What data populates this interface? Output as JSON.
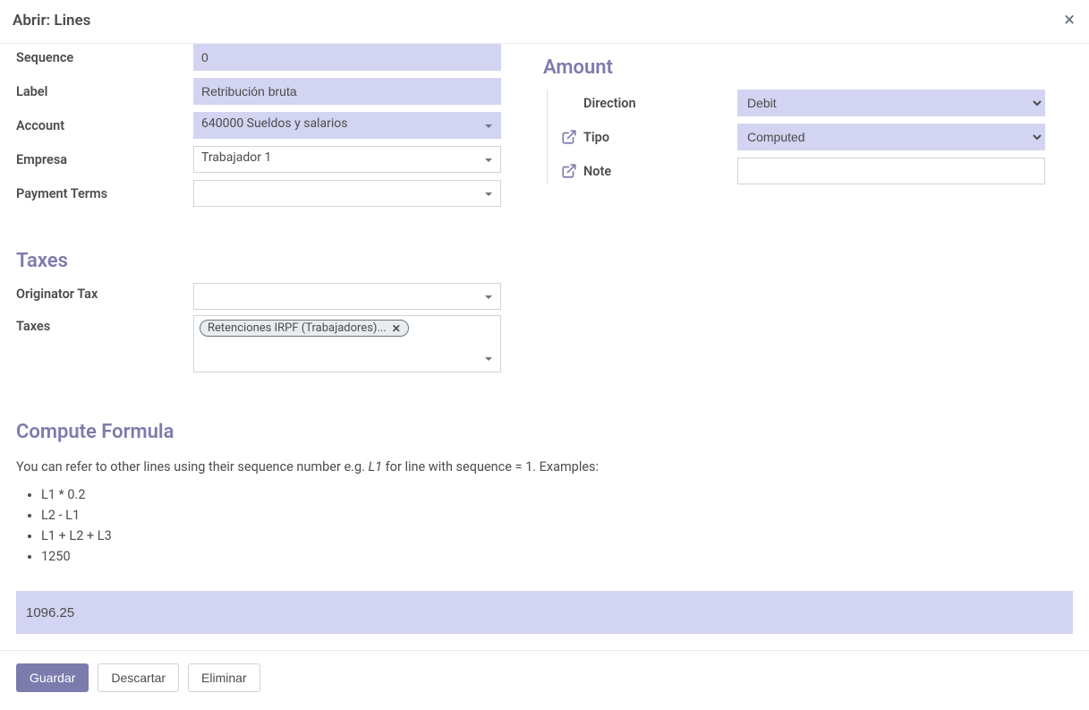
{
  "header": {
    "title": "Abrir: Lines"
  },
  "left": {
    "sequence_label": "Sequence",
    "sequence_value": "0",
    "label_label": "Label",
    "label_value": "Retribución bruta",
    "account_label": "Account",
    "account_value": "640000 Sueldos y salarios",
    "empresa_label": "Empresa",
    "empresa_value": "Trabajador 1",
    "payment_terms_label": "Payment Terms",
    "payment_terms_value": ""
  },
  "amount": {
    "title": "Amount",
    "direction_label": "Direction",
    "direction_value": "Debit",
    "tipo_label": "Tipo",
    "tipo_value": "Computed",
    "note_label": "Note",
    "note_value": ""
  },
  "taxes": {
    "title": "Taxes",
    "originator_label": "Originator Tax",
    "originator_value": "",
    "taxes_label": "Taxes",
    "tag_value": "Retenciones IRPF (Trabajadores)..."
  },
  "compute": {
    "title": "Compute Formula",
    "desc_pre": "You can refer to other lines using their sequence number e.g. ",
    "desc_em": "L1",
    "desc_post": " for line with sequence = 1. Examples:",
    "ex1": "L1 * 0.2",
    "ex2": "L2 - L1",
    "ex3": "L1 + L2 + L3",
    "ex4": "1250",
    "formula_value": "1096.25"
  },
  "footer": {
    "save": "Guardar",
    "discard": "Descartar",
    "delete": "Eliminar"
  }
}
